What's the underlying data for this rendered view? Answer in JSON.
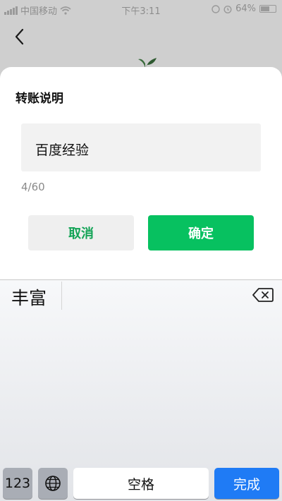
{
  "status_bar": {
    "carrier": "中国移动",
    "time": "下午3:11",
    "battery": "64%"
  },
  "icons": {
    "back": "chevron-left-icon",
    "plant": "sprout-icon",
    "wifi": "wifi-icon",
    "backspace": "backspace-icon",
    "globe": "globe-icon"
  },
  "dialog": {
    "title": "转账说明",
    "note_value": "百度经验",
    "char_count": "4/60",
    "cancel_label": "取消",
    "confirm_label": "确定"
  },
  "keyboard": {
    "candidates": [
      "丰富"
    ],
    "key_123": "123",
    "space_label": "空格",
    "done_label": "完成"
  },
  "colors": {
    "accent_green": "#07c160",
    "keyboard_blue": "#1f7bf5"
  }
}
